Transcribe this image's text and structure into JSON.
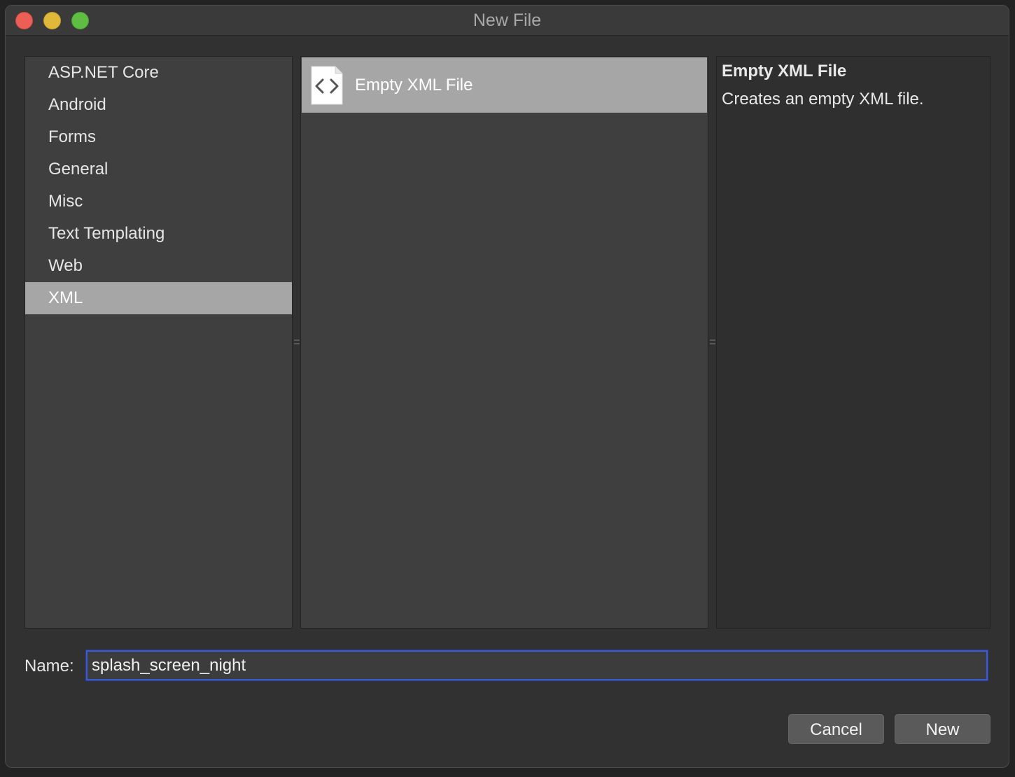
{
  "window": {
    "title": "New File"
  },
  "categories": {
    "items": [
      {
        "label": "ASP.NET Core"
      },
      {
        "label": "Android"
      },
      {
        "label": "Forms"
      },
      {
        "label": "General"
      },
      {
        "label": "Misc"
      },
      {
        "label": "Text Templating"
      },
      {
        "label": "Web"
      },
      {
        "label": "XML"
      }
    ],
    "selected": "XML"
  },
  "templates": {
    "items": [
      {
        "label": "Empty XML File",
        "icon": "xml-file-icon"
      }
    ],
    "selected": "Empty XML File"
  },
  "description": {
    "title": "Empty XML File",
    "text": "Creates an empty XML file."
  },
  "name_field": {
    "label": "Name:",
    "value": "splash_screen_night"
  },
  "buttons": {
    "cancel": "Cancel",
    "new": "New"
  },
  "colors": {
    "selection": "#a6a6a6",
    "focus_ring": "#3c5ad6"
  }
}
